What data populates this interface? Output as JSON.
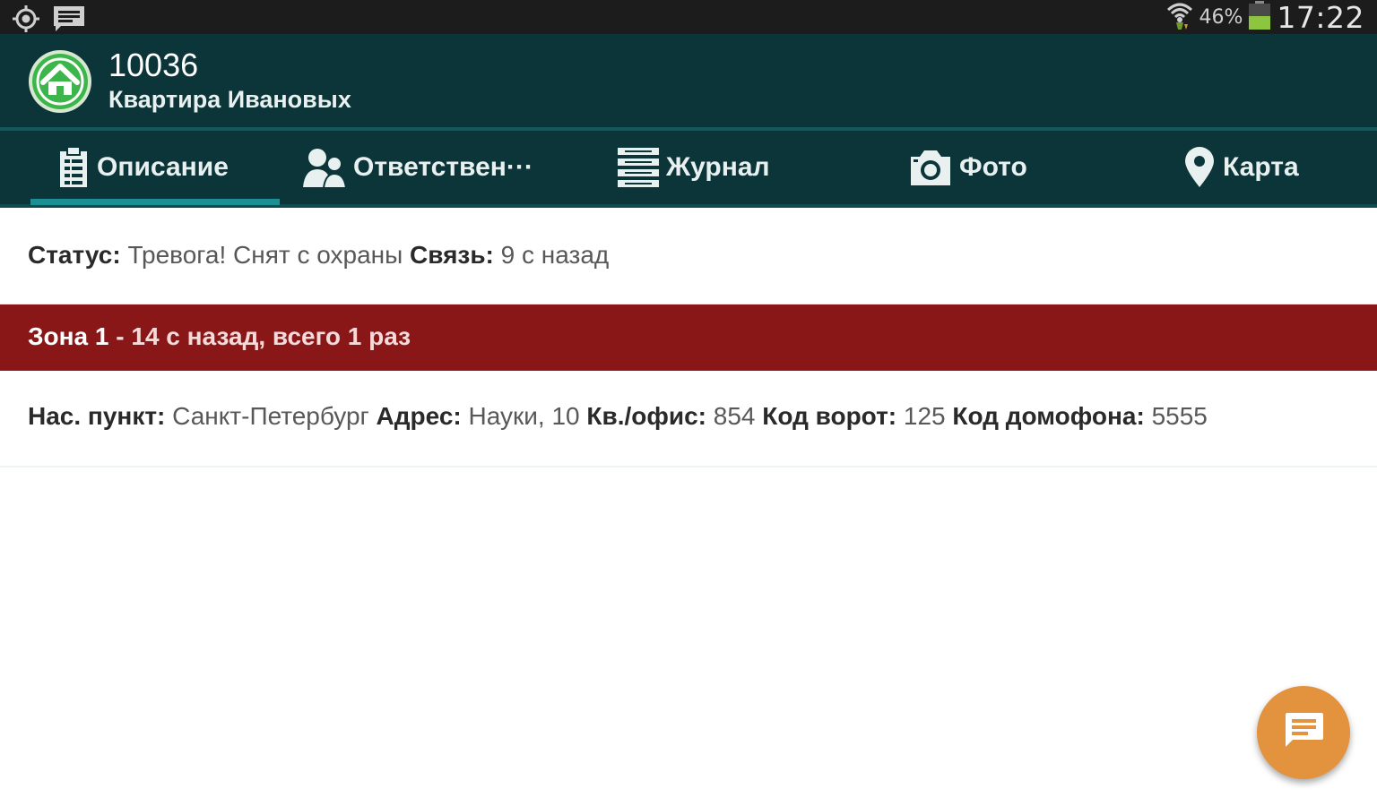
{
  "status_bar": {
    "battery_percent": "46%",
    "time": "17:22",
    "icons": [
      "gps-icon",
      "message-notification-icon",
      "wifi-icon",
      "battery-icon"
    ]
  },
  "app_bar": {
    "title": "10036",
    "subtitle": "Квартира Ивановых",
    "logo_icon": "home-icon"
  },
  "tabs": [
    {
      "label": "Описание",
      "icon": "clipboard-icon",
      "active": true
    },
    {
      "label": "Ответствен···",
      "icon": "people-icon",
      "active": false
    },
    {
      "label": "Журнал",
      "icon": "journal-icon",
      "active": false
    },
    {
      "label": "Фото",
      "icon": "camera-icon",
      "active": false
    },
    {
      "label": "Карта",
      "icon": "location-pin-icon",
      "active": false
    }
  ],
  "status": {
    "status_label": "Статус:",
    "status_value": "Тревога! Снят с охраны",
    "link_label": "Связь:",
    "link_value": "9 с назад"
  },
  "alarm": {
    "zone": "Зона 1",
    "details": "- 14 с назад, всего 1 раз"
  },
  "address": {
    "city_label": "Нас. пункт:",
    "city_value": "Санкт-Петербург",
    "address_label": "Адрес:",
    "address_value": "Науки, 10",
    "apt_label": "Кв./офис:",
    "apt_value": "854",
    "gate_label": "Код ворот:",
    "gate_value": "125",
    "intercom_label": "Код домофона:",
    "intercom_value": "5555"
  },
  "fab": {
    "icon": "chat-icon"
  },
  "colors": {
    "app_bar": "#0b3539",
    "tab_indicator": "#1b8f94",
    "alarm": "#8a1718",
    "fab": "#e3923e",
    "logo_green": "#3cb54a"
  }
}
